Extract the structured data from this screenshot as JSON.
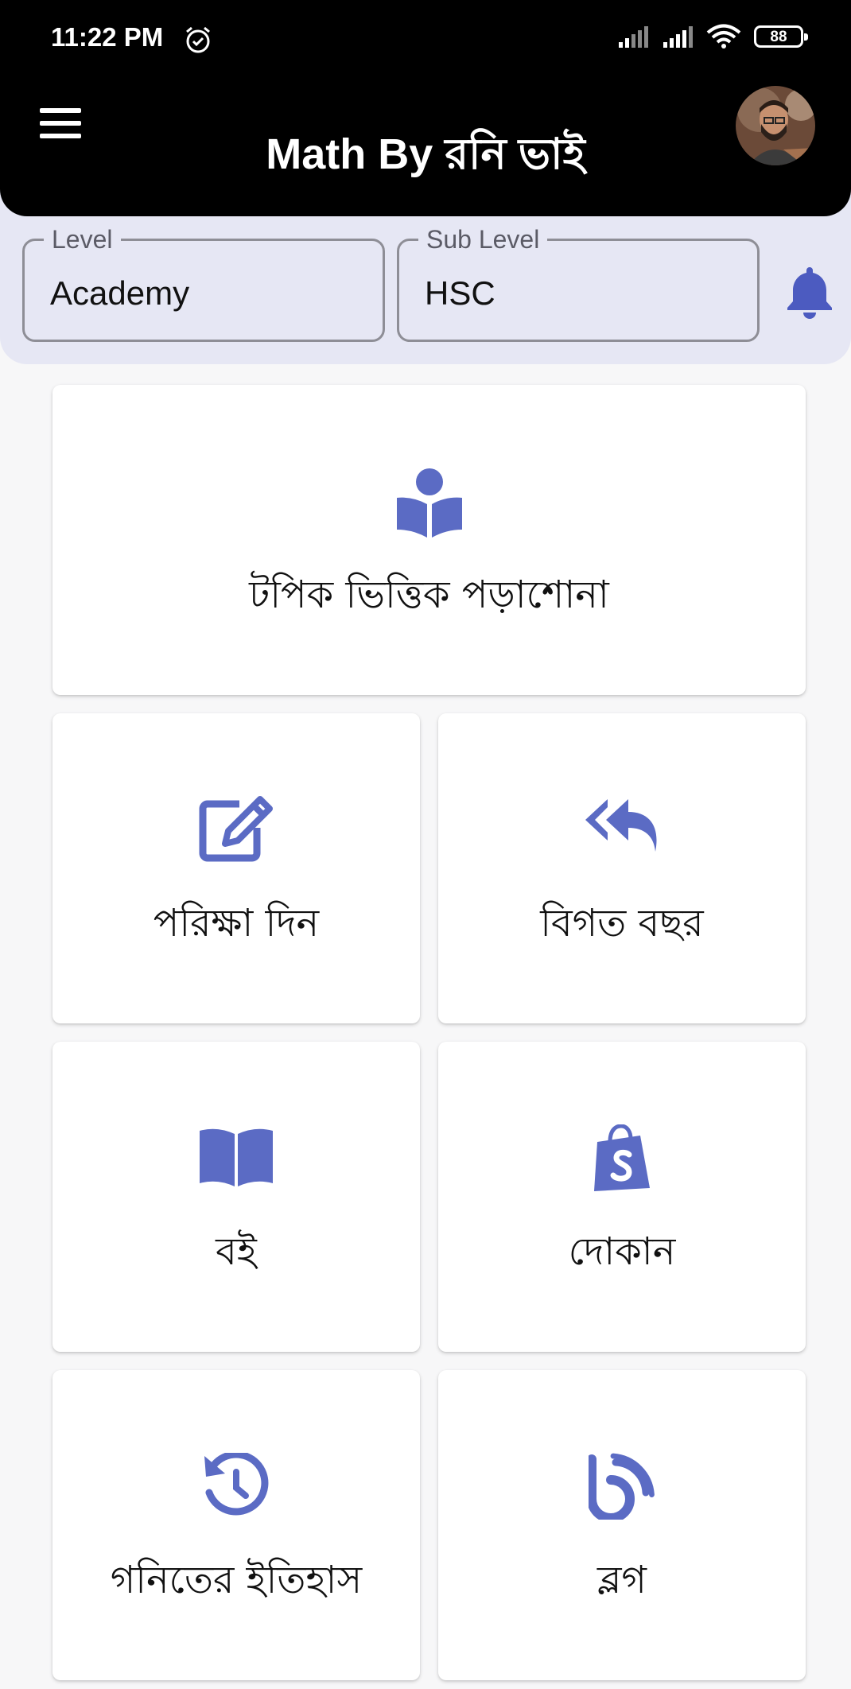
{
  "status_bar": {
    "time": "11:22 PM",
    "battery": "88",
    "icons": [
      "alarm-icon",
      "signal-icon",
      "signal-icon",
      "wifi-icon",
      "battery-icon"
    ]
  },
  "app_bar": {
    "title": "Math By রনি ভাই",
    "menu_icon": "hamburger-menu-icon",
    "avatar": "profile-avatar"
  },
  "filters": {
    "level": {
      "label": "Level",
      "value": "Academy"
    },
    "sub_level": {
      "label": "Sub Level",
      "value": "HSC"
    },
    "notification_icon": "bell-icon"
  },
  "menu": [
    {
      "label": "টপিক ভিত্তিক পড়াশোনা",
      "icon": "book-reader-icon"
    },
    {
      "label": "পরিক্ষা দিন",
      "icon": "edit-icon"
    },
    {
      "label": "বিগত বছর",
      "icon": "reply-all-icon"
    },
    {
      "label": "বই",
      "icon": "open-book-icon"
    },
    {
      "label": "দোকান",
      "icon": "shopify-bag-icon"
    },
    {
      "label": "গনিতের ইতিহাস",
      "icon": "history-icon"
    },
    {
      "label": "ব্লগ",
      "icon": "blog-icon"
    }
  ],
  "colors": {
    "accent": "#5b6bc4",
    "header": "#000000",
    "filter_bg": "#e6e7f4",
    "page_bg": "#f7f7f8"
  }
}
